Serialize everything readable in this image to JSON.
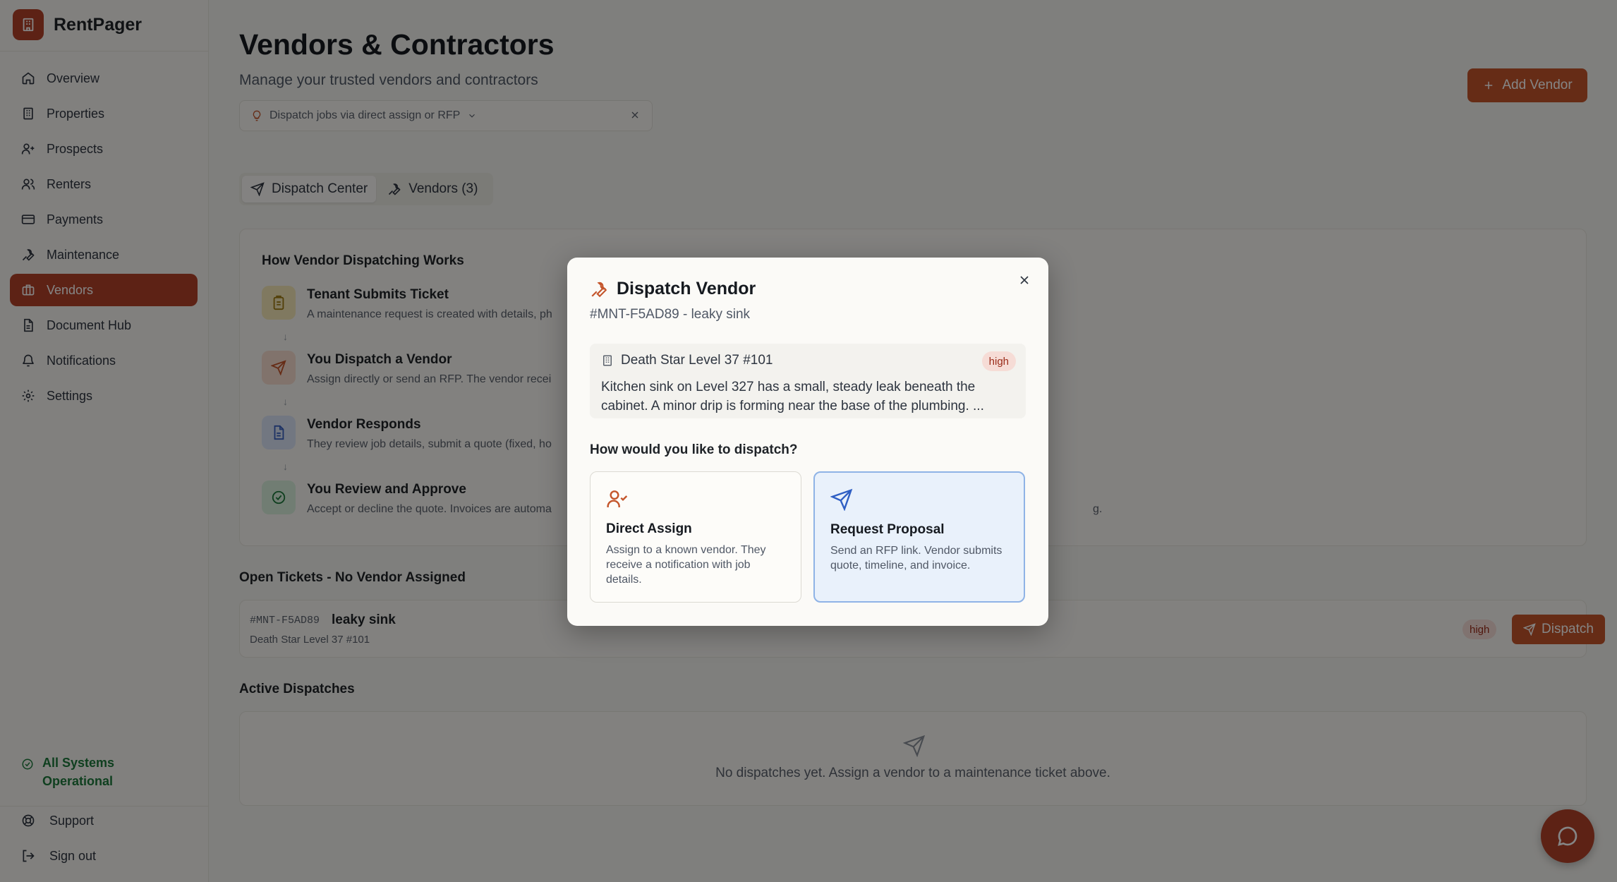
{
  "app": {
    "name": "RentPager"
  },
  "sidebar": {
    "items": [
      {
        "label": "Overview",
        "icon": "home-icon"
      },
      {
        "label": "Properties",
        "icon": "building-icon"
      },
      {
        "label": "Prospects",
        "icon": "user-plus-icon"
      },
      {
        "label": "Renters",
        "icon": "users-icon"
      },
      {
        "label": "Payments",
        "icon": "credit-card-icon"
      },
      {
        "label": "Maintenance",
        "icon": "wrench-icon"
      },
      {
        "label": "Vendors",
        "icon": "briefcase-icon",
        "active": true
      },
      {
        "label": "Document Hub",
        "icon": "file-icon"
      },
      {
        "label": "Notifications",
        "icon": "bell-icon"
      },
      {
        "label": "Settings",
        "icon": "gear-icon"
      }
    ],
    "status": "All Systems Operational",
    "support": "Support",
    "signout": "Sign out"
  },
  "page": {
    "title": "Vendors & Contractors",
    "subtitle": "Manage your trusted vendors and contractors",
    "hint": "Dispatch jobs via direct assign or RFP",
    "add_button": "Add Vendor"
  },
  "tabs": [
    {
      "label": "Dispatch Center",
      "active": true
    },
    {
      "label": "Vendors (3)",
      "active": false
    }
  ],
  "how": {
    "title": "How Vendor Dispatching Works",
    "steps": [
      {
        "title": "Tenant Submits Ticket",
        "desc": "A maintenance request is created with details, ph"
      },
      {
        "title": "You Dispatch a Vendor",
        "desc": "Assign directly or send an RFP. The vendor recei"
      },
      {
        "title": "Vendor Responds",
        "desc": "They review job details, submit a quote (fixed, ho"
      },
      {
        "title": "You Review and Approve",
        "desc": "Accept or decline the quote. Invoices are automa",
        "tail": "g."
      }
    ]
  },
  "open_tickets": {
    "title": "Open Tickets - No Vendor Assigned",
    "rows": [
      {
        "id": "#MNT-F5AD89",
        "title": "leaky sink",
        "location": "Death Star Level 37 #101",
        "priority": "high",
        "action": "Dispatch"
      }
    ]
  },
  "active_dispatches": {
    "title": "Active Dispatches",
    "empty": "No dispatches yet. Assign a vendor to a maintenance ticket above."
  },
  "modal": {
    "title": "Dispatch Vendor",
    "subtitle": "#MNT-F5AD89 - leaky sink",
    "property": "Death Star Level 37 #101",
    "priority": "high",
    "description": "Kitchen sink on Level 327 has a small, steady leak beneath the cabinet. A minor drip is forming near the base of the plumbing. ...",
    "question": "How would you like to dispatch?",
    "options": [
      {
        "title": "Direct Assign",
        "desc": "Assign to a known vendor. They receive a notification with job details."
      },
      {
        "title": "Request Proposal",
        "desc": "Send an RFP link. Vendor submits quote, timeline, and invoice."
      }
    ]
  },
  "colors": {
    "brand": "#b2412a",
    "accent": "#c4552b",
    "success": "#1d7a3c",
    "selected_border": "#8fb3e6"
  }
}
